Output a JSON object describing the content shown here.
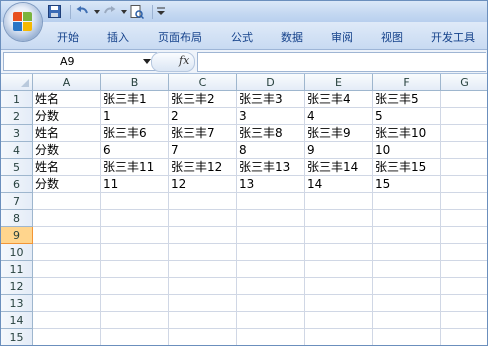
{
  "quick_access": {
    "icons": [
      "save-icon",
      "undo-icon",
      "redo-icon",
      "print-preview-icon",
      "customize-toolbar-icon"
    ]
  },
  "ribbon": {
    "tabs": [
      "开始",
      "插入",
      "页面布局",
      "公式",
      "数据",
      "审阅",
      "视图",
      "开发工具"
    ]
  },
  "formula_bar": {
    "name_box": "A9",
    "fx_label": "fx",
    "formula": ""
  },
  "sheet": {
    "columns": [
      "A",
      "B",
      "C",
      "D",
      "E",
      "F",
      "G"
    ],
    "rows": [
      "1",
      "2",
      "3",
      "4",
      "5",
      "6",
      "7",
      "8",
      "9",
      "10",
      "11",
      "12",
      "13",
      "14",
      "15"
    ],
    "selected_row": "9",
    "cells": [
      [
        "姓名",
        "张三丰1",
        "张三丰2",
        "张三丰3",
        "张三丰4",
        "张三丰5",
        ""
      ],
      [
        "分数",
        "1",
        "2",
        "3",
        "4",
        "5",
        ""
      ],
      [
        "姓名",
        "张三丰6",
        "张三丰7",
        "张三丰8",
        "张三丰9",
        "张三丰10",
        ""
      ],
      [
        "分数",
        "6",
        "7",
        "8",
        "9",
        "10",
        ""
      ],
      [
        "姓名",
        "张三丰11",
        "张三丰12",
        "张三丰13",
        "张三丰14",
        "张三丰15",
        ""
      ],
      [
        "分数",
        "11",
        "12",
        "13",
        "14",
        "15",
        ""
      ]
    ]
  },
  "colors": {
    "gridline": "#d0d7e5",
    "header_text": "#27413e",
    "ribbon_text": "#15428b",
    "selected_row_header": "#ffd58d"
  }
}
